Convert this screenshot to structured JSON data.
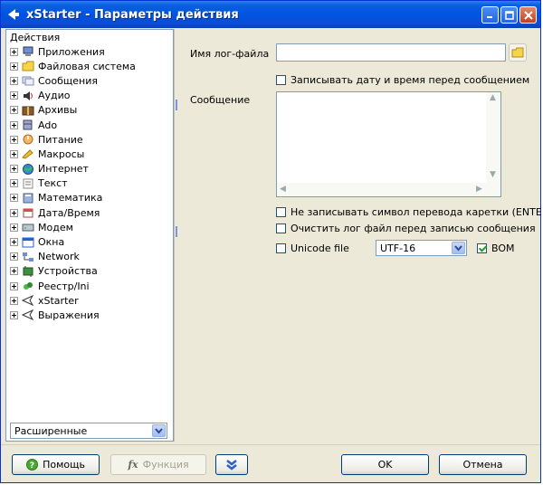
{
  "window": {
    "title": "xStarter - Параметры действия",
    "title_icon": "arrow-left-icon",
    "controls": [
      "minimize",
      "maximize",
      "close"
    ]
  },
  "tree": {
    "header": "Действия",
    "items": [
      {
        "label": "Приложения",
        "icon": "computer-icon"
      },
      {
        "label": "Файловая система",
        "icon": "folder-icon"
      },
      {
        "label": "Сообщения",
        "icon": "messages-icon"
      },
      {
        "label": "Аудио",
        "icon": "speaker-icon"
      },
      {
        "label": "Архивы",
        "icon": "archive-icon"
      },
      {
        "label": "Ado",
        "icon": "database-icon"
      },
      {
        "label": "Питание",
        "icon": "power-icon"
      },
      {
        "label": "Макросы",
        "icon": "macro-icon"
      },
      {
        "label": "Интернет",
        "icon": "globe-icon"
      },
      {
        "label": "Текст",
        "icon": "text-icon"
      },
      {
        "label": "Математика",
        "icon": "calculator-icon"
      },
      {
        "label": "Дата/Время",
        "icon": "calendar-icon"
      },
      {
        "label": "Модем",
        "icon": "modem-icon"
      },
      {
        "label": "Окна",
        "icon": "window-icon"
      },
      {
        "label": "Network",
        "icon": "network-icon"
      },
      {
        "label": "Устройства",
        "icon": "device-icon"
      },
      {
        "label": "Реестр/Ini",
        "icon": "registry-icon"
      },
      {
        "label": "xStarter",
        "icon": "xstarter-icon"
      },
      {
        "label": "Выражения",
        "icon": "expression-icon"
      }
    ],
    "mode_select": {
      "value": "Расширенные"
    }
  },
  "form": {
    "log_file_label": "Имя лог-файла",
    "log_file_value": "",
    "write_datetime": {
      "label": "Записывать дату и время перед сообщением",
      "checked": false
    },
    "message_label": "Сообщение",
    "message_value": "",
    "no_newline": {
      "label": "Не записывать символ перевода каретки (ENTER) после сообщения",
      "checked": false
    },
    "clear_log": {
      "label": "Очистить лог файл перед записью сообщения",
      "checked": false
    },
    "unicode": {
      "label": "Unicode file",
      "checked": false
    },
    "encoding": {
      "value": "UTF-16"
    },
    "bom": {
      "label": "BOM",
      "checked": true
    }
  },
  "buttons": {
    "help": "Помощь",
    "function": "Функция",
    "ok": "OK",
    "cancel": "Отмена"
  },
  "colors": {
    "titlebar": "#0054e3",
    "window_bg": "#ece9d8",
    "field_border": "#7f9db9"
  }
}
